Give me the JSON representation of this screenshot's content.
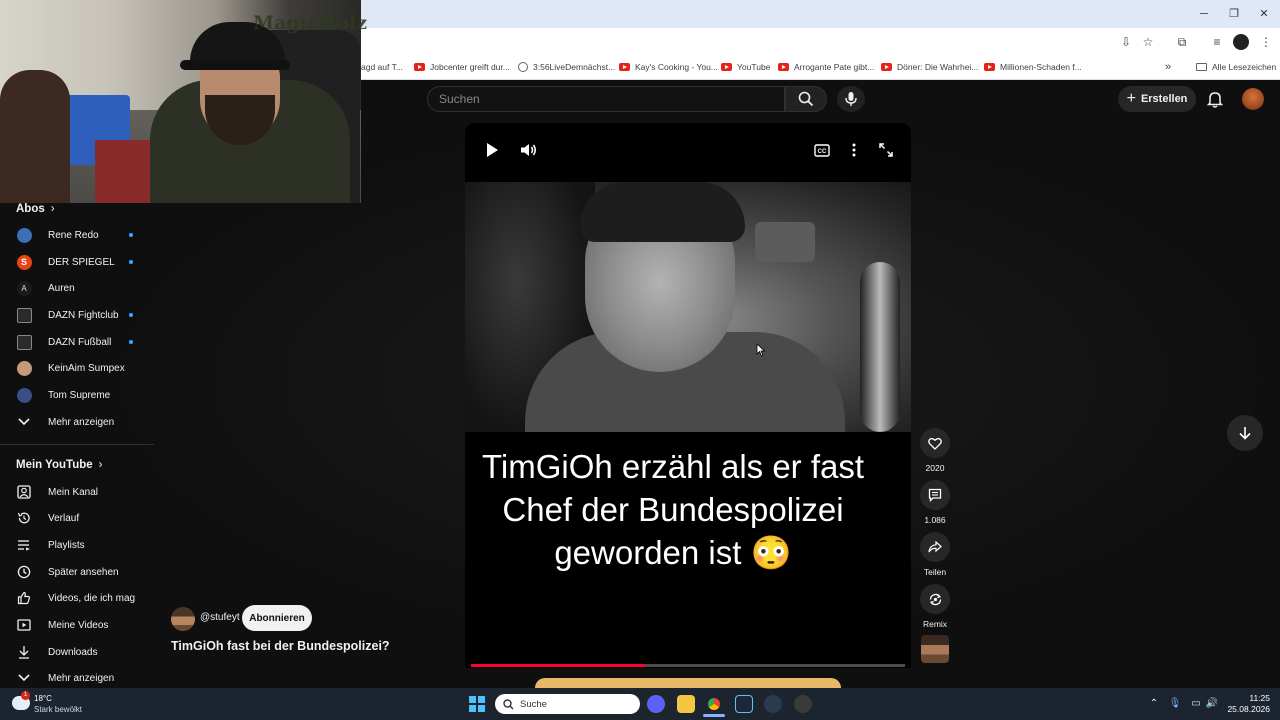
{
  "browser": {
    "bookmarks": [
      {
        "label": "agd auf T...",
        "icon": "none"
      },
      {
        "label": "Jobcenter greift dur...",
        "icon": "youtube"
      },
      {
        "label": "3:56LiveDemnächst...",
        "icon": "globe"
      },
      {
        "label": "Kay's Cooking - You...",
        "icon": "youtube"
      },
      {
        "label": "YouTube",
        "icon": "youtube"
      },
      {
        "label": "Arrogante Pate gibt...",
        "icon": "youtube"
      },
      {
        "label": "Döner: Die Wahrhei...",
        "icon": "youtube"
      },
      {
        "label": "Millionen-Schaden f...",
        "icon": "youtube"
      }
    ],
    "more_bookmarks": "»",
    "all_bookmarks": "Alle Lesezeichen"
  },
  "webcam": {
    "logo_text": "MagicHolz"
  },
  "header": {
    "search_placeholder": "Suchen",
    "create_label": "Erstellen"
  },
  "sidebar": {
    "subscriptions_title": "Abos",
    "subscriptions": [
      {
        "name": "Rene Redo",
        "avatar": "#3b6fb6",
        "new": true
      },
      {
        "name": "DER SPIEGEL",
        "avatar": "#e64415",
        "new": true
      },
      {
        "name": "Auren",
        "avatar": "#1a1a1a",
        "new": false
      },
      {
        "name": "DAZN Fightclub",
        "avatar": "#2a2a2a",
        "new": true
      },
      {
        "name": "DAZN Fußball",
        "avatar": "#2a2a2a",
        "new": true
      },
      {
        "name": "KeinAim Sumpex",
        "avatar": "#c49a7a",
        "new": false
      },
      {
        "name": "Tom Supreme",
        "avatar": "#3a4f8a",
        "new": false
      }
    ],
    "show_more_1": "Mehr anzeigen",
    "you_title": "Mein YouTube",
    "you_items": [
      {
        "label": "Mein Kanal",
        "icon": "person-box-icon"
      },
      {
        "label": "Verlauf",
        "icon": "history-icon"
      },
      {
        "label": "Playlists",
        "icon": "playlist-icon"
      },
      {
        "label": "Später ansehen",
        "icon": "clock-icon"
      },
      {
        "label": "Videos, die ich mag",
        "icon": "thumbs-up-icon"
      },
      {
        "label": "Meine Videos",
        "icon": "video-box-icon"
      },
      {
        "label": "Downloads",
        "icon": "download-icon"
      }
    ],
    "show_more_2": "Mehr anzeigen"
  },
  "short": {
    "caption": "TimGiOh erzähl als er fast Chef der Bundespolizei geworden ist 😳",
    "channel": "@stufeyt",
    "subscribe_label": "Abonnieren",
    "title": "TimGiOh fast bei der Bundespolizei?",
    "progress_fraction": 0.4,
    "likes": "2020",
    "comments": "1.086",
    "share_label": "Teilen",
    "remix_label": "Remix"
  },
  "taskbar": {
    "weather_temp": "18°C",
    "weather_desc": "Stark bewölkt",
    "weather_badge": "1",
    "search_label": "Suche",
    "time": "11:25",
    "date": "25.08.2026"
  }
}
